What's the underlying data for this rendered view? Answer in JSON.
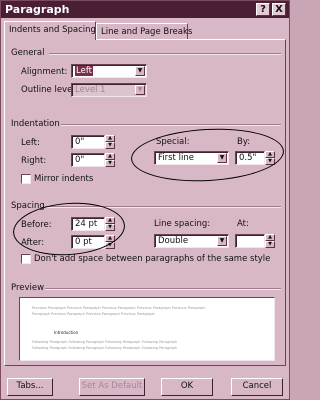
{
  "window": {
    "title": "Paragraph"
  },
  "titlebar": {
    "help": "?",
    "close": "X"
  },
  "tabs": [
    {
      "label": "Indents and Spacing"
    },
    {
      "label": "Line and Page Breaks"
    }
  ],
  "general": {
    "heading": "General",
    "alignment_label": "Alignment:",
    "alignment_value": "Left",
    "outline_label": "Outline level:",
    "outline_value": "Level 1"
  },
  "indentation": {
    "heading": "Indentation",
    "left_label": "Left:",
    "left_value": "0\"",
    "right_label": "Right:",
    "right_value": "0\"",
    "special_label": "Special:",
    "special_value": "First line",
    "by_label": "By:",
    "by_value": "0.5\"",
    "mirror_label": "Mirror indents"
  },
  "spacing": {
    "heading": "Spacing",
    "before_label": "Before:",
    "before_value": "24 pt",
    "after_label": "After:",
    "after_value": "0 pt",
    "line_spacing_label": "Line spacing:",
    "line_spacing_value": "Double",
    "at_label": "At:",
    "at_value": "",
    "dont_add_label": "Don't add space between paragraphs of the same style"
  },
  "preview": {
    "heading": "Preview",
    "prev_line_1": "Previous Paragraph Previous Paragraph Previous Paragraph Previous Paragraph Previous Paragraph",
    "prev_line_2": "Paragraph Previous Paragraph Previous Paragraph Previous Paragraph",
    "current": "Introduction",
    "follow_line_1": "Following Paragraph Following Paragraph Following Paragraph Following Paragraph",
    "follow_line_2": "Following Paragraph Following Paragraph Following Paragraph Following Paragraph"
  },
  "buttons": {
    "tabs": "Tabs...",
    "set_default": "Set As Default",
    "ok": "OK",
    "cancel": "Cancel"
  }
}
